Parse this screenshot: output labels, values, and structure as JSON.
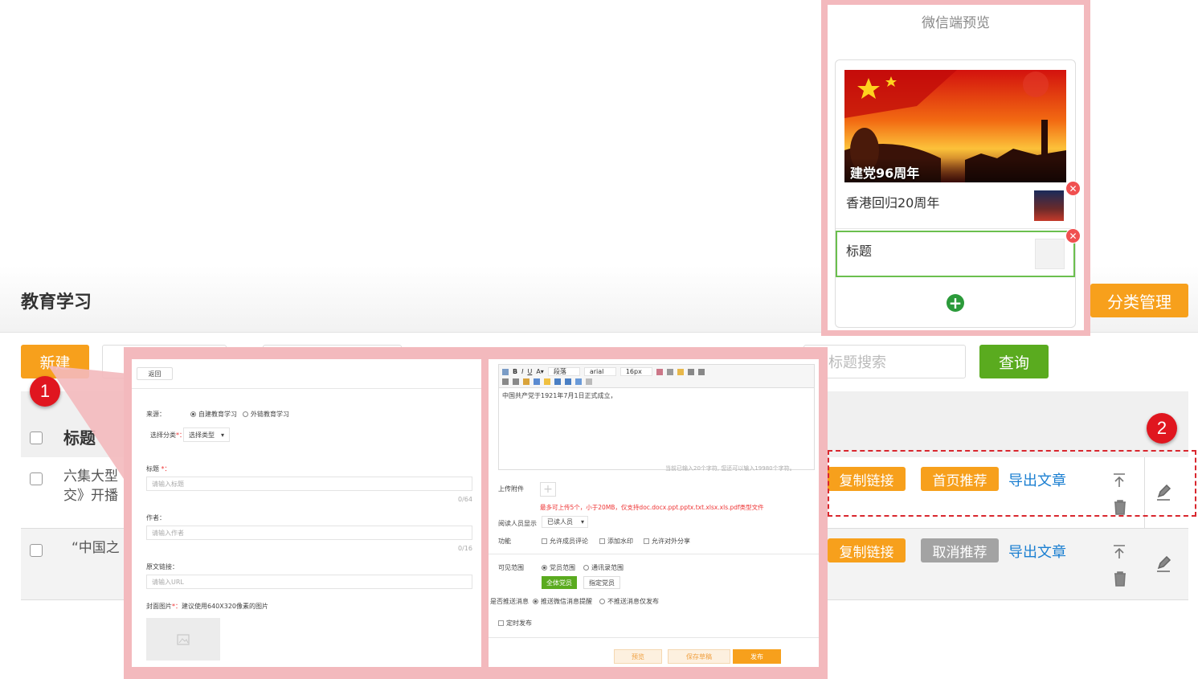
{
  "page": {
    "title": "教育学习",
    "category_button": "分类管理",
    "new_button": "新建",
    "search_placeholder": "标题搜索",
    "query_button": "查询"
  },
  "table": {
    "header_title": "标题",
    "rows": [
      {
        "title_line1": "六集大型",
        "title_line2": "交》开播",
        "copy_link": "复制链接",
        "recommend": "首页推荐",
        "export": "导出文章"
      },
      {
        "title_line1": "“中国之",
        "copy_link": "复制链接",
        "recommend": "取消推荐",
        "export": "导出文章"
      }
    ]
  },
  "markers": [
    "1",
    "2"
  ],
  "preview": {
    "title": "微信端预览",
    "cover_caption": "建党96周年",
    "items": [
      "香港回归20周年",
      "标题"
    ]
  },
  "form": {
    "back": "返回",
    "source_label": "来源：",
    "source_opt1": "自建教育学习",
    "source_opt2": "外链教育学习",
    "category_label": "选择分类",
    "category_required": "*：",
    "category_select": "选择类型",
    "title_label": "标题",
    "title_required": " *：",
    "title_placeholder": "请输入标题",
    "title_count": "0/64",
    "author_label": "作者：",
    "author_placeholder": "请输入作者",
    "author_count": "0/16",
    "link_label": "原文链接：",
    "link_placeholder": "请输入URL",
    "cover_label": "封面图片",
    "cover_required": "*：",
    "cover_hint": "建议使用640X320像素的图片"
  },
  "editor": {
    "paragraph": "段落",
    "font": "arial",
    "size": "16px",
    "content": "中国共产党于1921年7月1日正式成立，",
    "counter": "当前已输入20个字符, 您还可以输入19980个字符。",
    "upload_label": "上传附件",
    "upload_hint": "最多可上传5个，小于20MB，仅支持doc.docx.ppt.pptx.txt.xlsx.xls.pdf类型文件",
    "reader_label": "阅读人员显示",
    "reader_select": "已读人员",
    "func_label": "功能",
    "func_opt1": "允许成员评论",
    "func_opt2": "添加水印",
    "func_opt3": "允许对外分享",
    "scope_label": "可见范围",
    "scope_opt1": "党员范围",
    "scope_opt2": "通讯录范围",
    "scope_btn1": "全体党员",
    "scope_btn2": "指定党员",
    "push_label": "是否推送消息",
    "push_opt1": "推送微信消息提醒",
    "push_opt2": "不推送消息仅发布",
    "schedule": "定时发布",
    "btn_preview": "预览",
    "btn_draft": "保存草稿",
    "btn_publish": "发布"
  }
}
